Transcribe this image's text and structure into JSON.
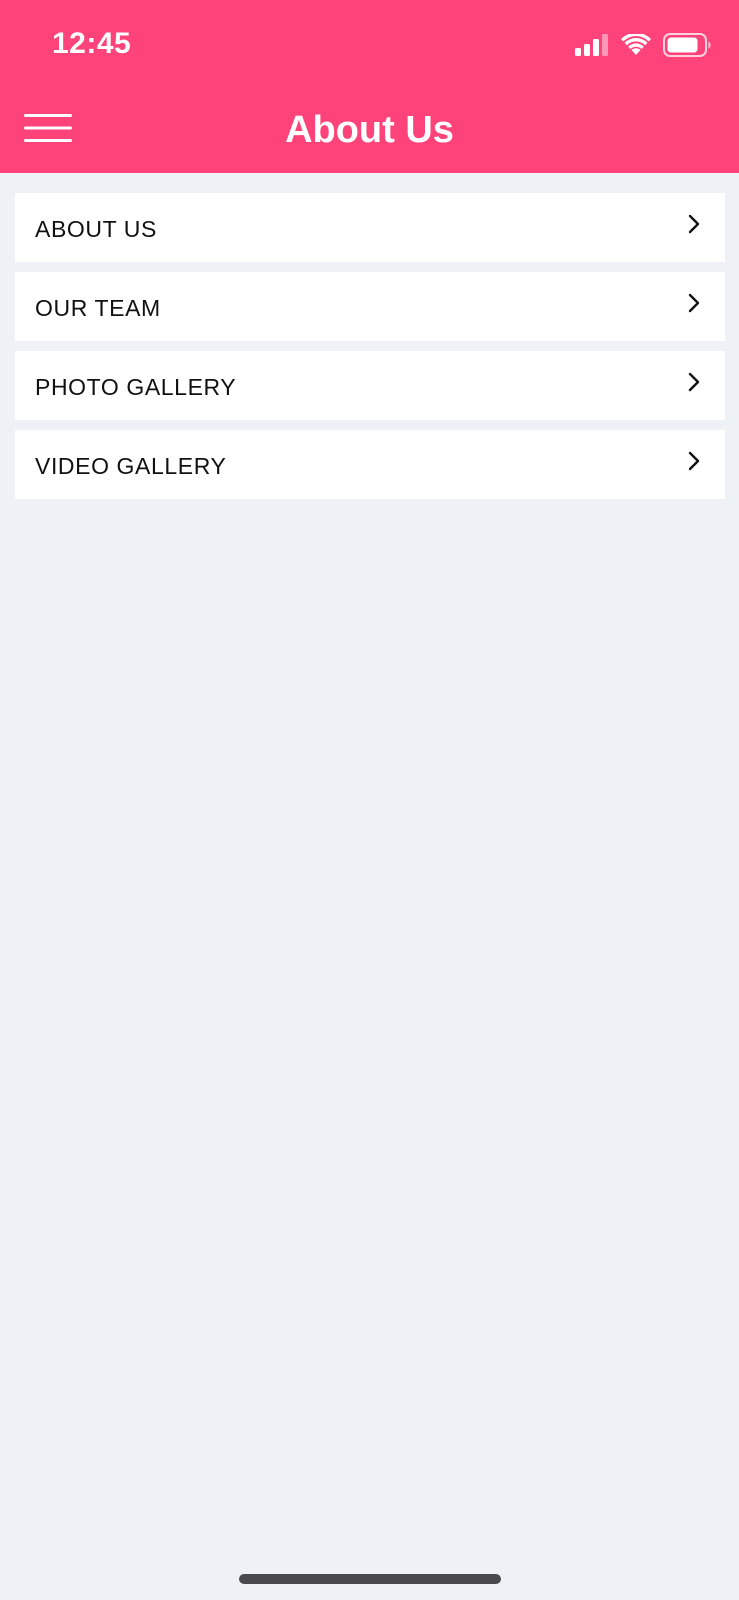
{
  "status_bar": {
    "time": "12:45",
    "icons": [
      "cellular-signal-icon",
      "wifi-icon",
      "battery-icon"
    ]
  },
  "header": {
    "title": "About Us",
    "menu_icon": "hamburger-menu-icon"
  },
  "menu": {
    "items": [
      {
        "label": "ABOUT US",
        "icon": "chevron-right-icon"
      },
      {
        "label": "OUR TEAM",
        "icon": "chevron-right-icon"
      },
      {
        "label": "PHOTO GALLERY",
        "icon": "chevron-right-icon"
      },
      {
        "label": "VIDEO GALLERY",
        "icon": "chevron-right-icon"
      }
    ]
  },
  "colors": {
    "brand": "#fd4379",
    "background": "#eef1f6",
    "row_background": "#ffffff",
    "text": "#111111"
  }
}
